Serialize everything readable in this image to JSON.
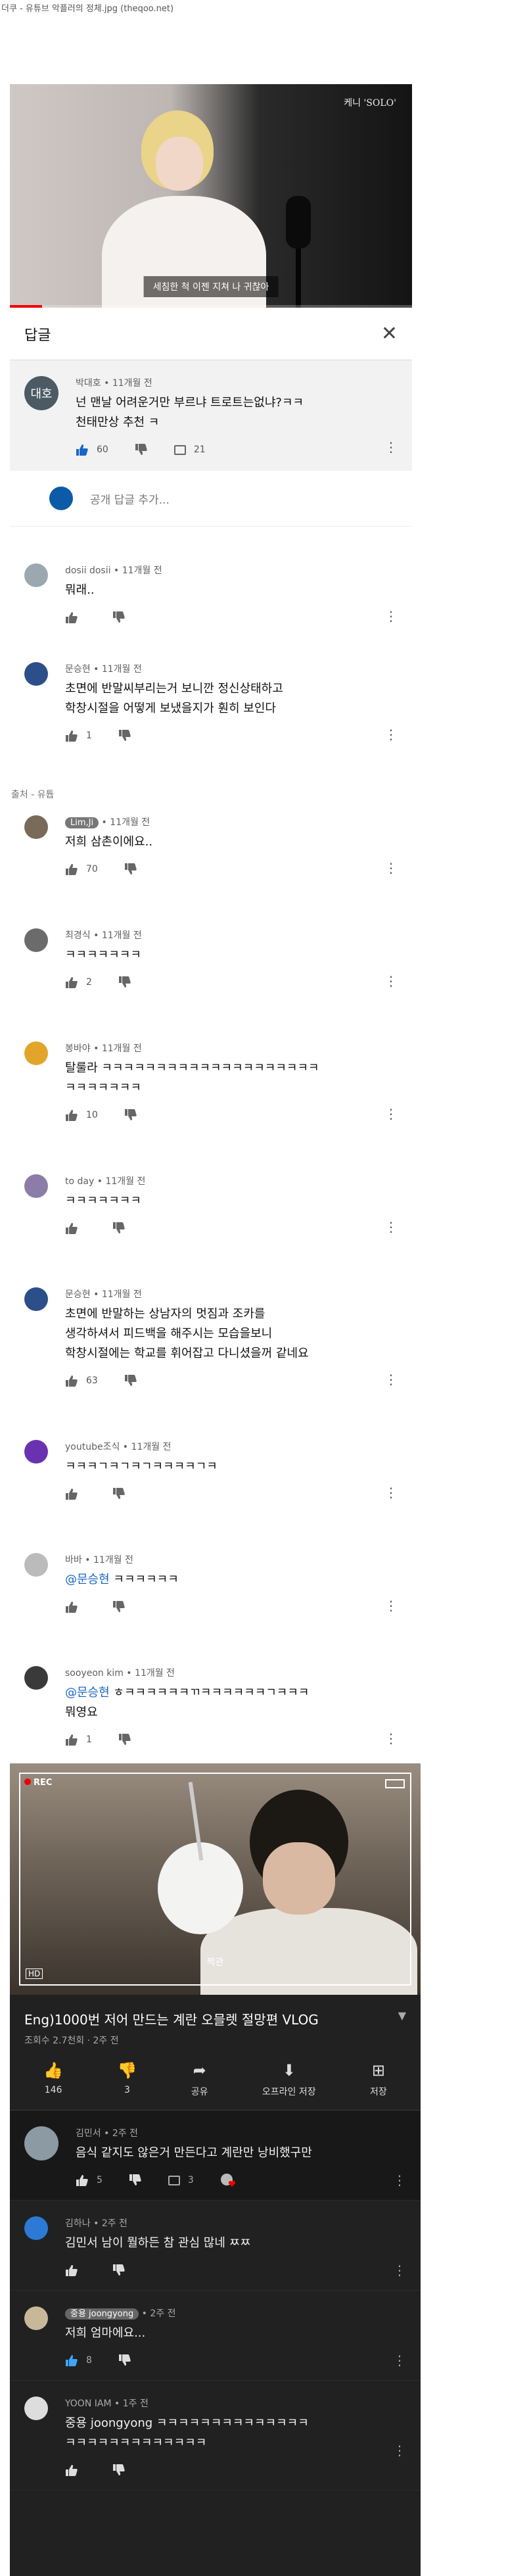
{
  "header": {
    "caption": "더쿠 - 유튜브 악플러의 정체.jpg  (theqoo.net)"
  },
  "video1": {
    "watermark": "케니 'SOLO'",
    "subtitle": "세침한 척 이젠 지쳐 나 귀찮아"
  },
  "comments_panel": {
    "title": "답글",
    "close_icon": "close-icon"
  },
  "pinned": {
    "avatar_text": "대호",
    "author": "박대호",
    "time": "11개월 전",
    "text": "넌 맨날 어려운거만 부르냐 트로트는없냐?ㅋㅋ\n천태만상 추천 ㅋ",
    "likes": "60",
    "replies": "21"
  },
  "add_comment": {
    "placeholder": "공개 답글 추가..."
  },
  "light_comments": [
    {
      "author": "dosii dosii",
      "time": "11개월 전",
      "text": "뭐래..",
      "likes": ""
    },
    {
      "author": "문승현",
      "time": "11개월 전",
      "text": "초면에 반말씨부리는거 보니깐 정신상태하고\n학창시절을 어떻게 보냈을지가 훤히 보인다",
      "likes": "1"
    }
  ],
  "source_note": "출처 - 유튭",
  "light_comments2": [
    {
      "author": "Lim,Ji",
      "time": "11개월 전",
      "text": "저희 삼촌이에요..",
      "likes": "70",
      "tag": true
    },
    {
      "author": "최경식",
      "time": "11개월 전",
      "text": "ㅋㅋㅋㅋㅋㅋㅋ",
      "likes": "2"
    },
    {
      "author": "봉바야",
      "time": "11개월 전",
      "text": "탈룰라 ㅋㅋㅋㅋㅋㅋㅋㅋㅋㅋㅋㅋㅋㅋㅋㅋㅋㅋㅋㅋ\nㅋㅋㅋㅋㅋㅋㅋ",
      "likes": "10"
    },
    {
      "author": "to day",
      "time": "11개월 전",
      "text": "ㅋㅋㅋㅋㅋㅋㅋ",
      "likes": ""
    },
    {
      "author": "문승현",
      "time": "11개월 전",
      "text": "초면에 반말하는 상남자의 멋짐과 조카를\n생각하셔서 피드백을 해주시는 모습을보니\n학창시절에는 학교를 휘어잡고 다니셨을꺼 같네요",
      "likes": "63"
    },
    {
      "author": "youtube조식",
      "time": "11개월 전",
      "text": "ㅋㅋㅋㄱㅋㄱㅋㄱㅋㅋㅋㅋㄱㅋ",
      "likes": ""
    },
    {
      "author": "바바",
      "time": "11개월 전",
      "mention": "@문승현",
      "text": " ㅋㅋㅋㅋㅋㅋ",
      "likes": ""
    },
    {
      "author": "sooyeon kim",
      "time": "11개월 전",
      "mention": "@문승현",
      "text": " ㅎㅋㅋㅋㅋㅋㅋㄲㅋㅋㅋㅋㅋㅋㄱㅋㅋㅋ\n뭐영요",
      "likes": "1"
    }
  ],
  "video2": {
    "rec": "REC",
    "hd": "HD",
    "caption": "짝관",
    "title": "Eng)1000번 저어 만드는 계란 오믈렛 절망편 VLOG",
    "sub": "조회수 2.7천회 · 2주 전",
    "actions": [
      {
        "icon": "like-icon",
        "glyph": "👍",
        "label": "146"
      },
      {
        "icon": "dislike-icon",
        "glyph": "👎",
        "label": "3"
      },
      {
        "icon": "share-icon",
        "glyph": "➦",
        "label": "공유"
      },
      {
        "icon": "download-icon",
        "glyph": "⬇",
        "label": "오프라인 저장"
      },
      {
        "icon": "save-icon",
        "glyph": "⊞",
        "label": "저장"
      }
    ]
  },
  "dark_comments": [
    {
      "author": "김민서",
      "time": "2주 전",
      "text": "음식 같지도 않은거 만든다고 계란만 낭비했구만",
      "likes": "5",
      "replies": "3"
    },
    {
      "author": "김하나",
      "time": "2주 전",
      "text": "김민서 남이 뭘하든 참 관심 많네 ㅉㅉ",
      "likes": ""
    },
    {
      "author": "중용 joongyong",
      "time": "2주 전",
      "text": "저희 엄마에요...",
      "likes": "8",
      "tag": true
    },
    {
      "author": "YOON IAM",
      "time": "1주 전",
      "text": "중용 joongyong ㅋㅋㅋㅋㅋㅋㅋㅋㅋㅋㅋㅋㅋㅋ\nㅋㅋㅋㅋㅋㅋㅋㅋㅋㅋㅋㅋㅋ",
      "likes": ""
    }
  ],
  "colors": {
    "accent_blue": "#1a66c8",
    "dark_bg": "#212121",
    "pinned_bg": "#f2f2f2"
  }
}
